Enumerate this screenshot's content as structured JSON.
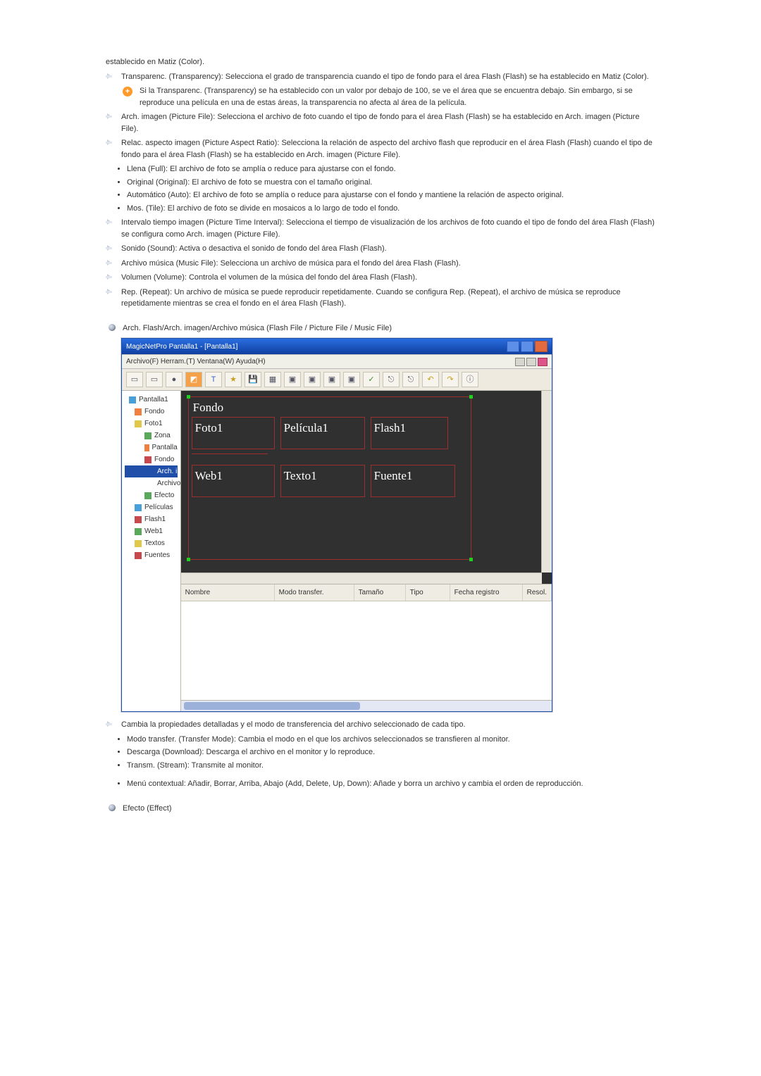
{
  "intro_line": "establecido en Matiz (Color).",
  "items": {
    "transparency": "Transparenc. (Transparency): Selecciona el grado de transparencia cuando el tipo de fondo para el área Flash (Flash) se ha establecido en Matiz (Color).",
    "transparency_note": "Si la Transparenc. (Transparency) se ha establecido con un valor por debajo de 100, se ve el área que se encuentra debajo. Sin embargo, si se reproduce una película en una de estas áreas, la transparencia no afecta al área de la película.",
    "picture_file": "Arch. imagen (Picture File): Selecciona el archivo de foto cuando el tipo de fondo para el área Flash (Flash) se ha establecido en Arch. imagen (Picture File).",
    "aspect_intro": "Relac. aspecto imagen (Picture Aspect Ratio): Selecciona la relación de aspecto del archivo flash que reproducir en el área Flash (Flash) cuando el tipo de fondo para el área Flash (Flash) se ha establecido en Arch. imagen (Picture File).",
    "aspect_opts": [
      "Llena (Full): El archivo de foto se amplía o reduce para ajustarse con el fondo.",
      "Original (Original): El archivo de foto se muestra con el tamaño original.",
      "Automático (Auto): El archivo de foto se amplía o reduce para ajustarse con el fondo y mantiene la relación de aspecto original.",
      "Mos. (Tile): El archivo de foto se divide en mosaicos a lo largo de todo el fondo."
    ],
    "time_interval": "Intervalo tiempo imagen (Picture Time Interval): Selecciona el tiempo de visualización de los archivos de foto cuando el tipo de fondo del área Flash (Flash) se configura como Arch. imagen (Picture File).",
    "sound": "Sonido (Sound): Activa o desactiva el sonido de fondo del área Flash (Flash).",
    "music_file": "Archivo música (Music File): Selecciona un archivo de música para el fondo del área Flash (Flash).",
    "volume": "Volumen (Volume): Controla el volumen de la música del fondo del área Flash (Flash).",
    "repeat": "Rep. (Repeat): Un archivo de música se puede reproducir repetidamente. Cuando se configura Rep. (Repeat), el archivo de música se reproduce repetidamente mientras se crea el fondo en el área Flash (Flash)."
  },
  "section_files_head": "Arch. Flash/Arch. imagen/Archivo música (Flash File / Picture File / Music File)",
  "app": {
    "title": "MagicNetPro Pantalla1 - [Pantalla1]",
    "menu": "Archivo(F)  Herram.(T)  Ventana(W)  Ayuda(H)",
    "tree": {
      "root": "Pantalla1",
      "fondo": "Fondo",
      "foto1": "Foto1",
      "zona": "Zona",
      "pantalla": "Pantalla",
      "fondo2": "Fondo",
      "arch_imagen_sel": "Arch. imagen",
      "archivo_musica": "Archivo música",
      "efecto": "Efecto",
      "peliculas": "Películas",
      "flash1": "Flash1",
      "web1": "Web1",
      "textos": "Textos",
      "fuentes": "Fuentes"
    },
    "canvas": {
      "bg_label": "Fondo",
      "cells": {
        "foto1": "Foto1",
        "pelicula1": "Película1",
        "flash1": "Flash1",
        "web1": "Web1",
        "texto1": "Texto1",
        "fuente1": "Fuente1"
      }
    },
    "grid_headers": {
      "nombre": "Nombre",
      "modo": "Modo transfer.",
      "tam": "Tamaño",
      "tipo": "Tipo",
      "fecha": "Fecha registro",
      "resol": "Resol."
    }
  },
  "below_shot": {
    "change_props": "Cambia la propiedades detalladas y el modo de transferencia del archivo seleccionado de cada tipo.",
    "opts": [
      "Modo transfer. (Transfer Mode): Cambia el modo en el que los archivos seleccionados se transfieren al monitor.",
      "Descarga (Download): Descarga el archivo en el monitor y lo reproduce.",
      "Transm. (Stream): Transmite al monitor."
    ],
    "context_menu": "Menú contextual: Añadir, Borrar, Arriba, Abajo (Add, Delete, Up, Down): Añade y borra un archivo y cambia el orden de reproducción."
  },
  "section_effect_head": "Efecto (Effect)"
}
